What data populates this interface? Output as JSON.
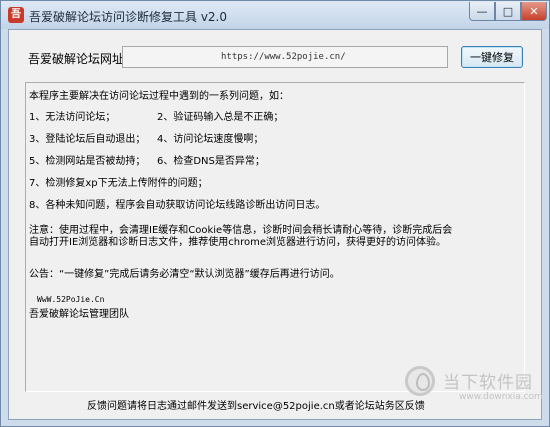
{
  "window": {
    "title": "吾爱破解论坛访问诊断修复工具 v2.0",
    "app_icon": "吾",
    "minimize": "—",
    "maximize": "□",
    "close": "✕"
  },
  "url_row": {
    "label": "吾爱破解论坛网址：",
    "value": "https://www.52pojie.cn/",
    "repair_button": "一键修复"
  },
  "info": {
    "intro": "本程序主要解决在访问论坛过程中遇到的一系列问题，如：",
    "items": [
      [
        "1、无法访问论坛；",
        "2、验证码输入总是不正确；"
      ],
      [
        "3、登陆论坛后自动退出；",
        "4、访问论坛速度慢啊；"
      ],
      [
        "5、检测网站是否被劫持；",
        "6、检查DNS是否异常；"
      ],
      [
        "7、检测修复xp下无法上传附件的问题；",
        ""
      ],
      [
        "8、各种未知问题，程序会自动获取访问论坛线路诊断出访问日志。",
        ""
      ]
    ],
    "note_line1": "注意：使用过程中，会清理IE缓存和Cookie等信息，诊断时间会稍长请耐心等待，诊断完成后会",
    "note_line2": "自动打开IE浏览器和诊断日志文件，推荐使用chrome浏览器进行访问，获得更好的访问体验。",
    "announcement": "公告：“一键修复”完成后请务必清空“默认浏览器”缓存后再进行访问。",
    "site_small": "WwW.52PoJie.Cn",
    "team": "吾爱破解论坛管理团队"
  },
  "footer": {
    "text": "反馈问题请将日志通过邮件发送到service@52pojie.cn或者论坛站务区反馈"
  },
  "watermark": {
    "name": "当下软件园",
    "url": "www.downxia.com"
  }
}
